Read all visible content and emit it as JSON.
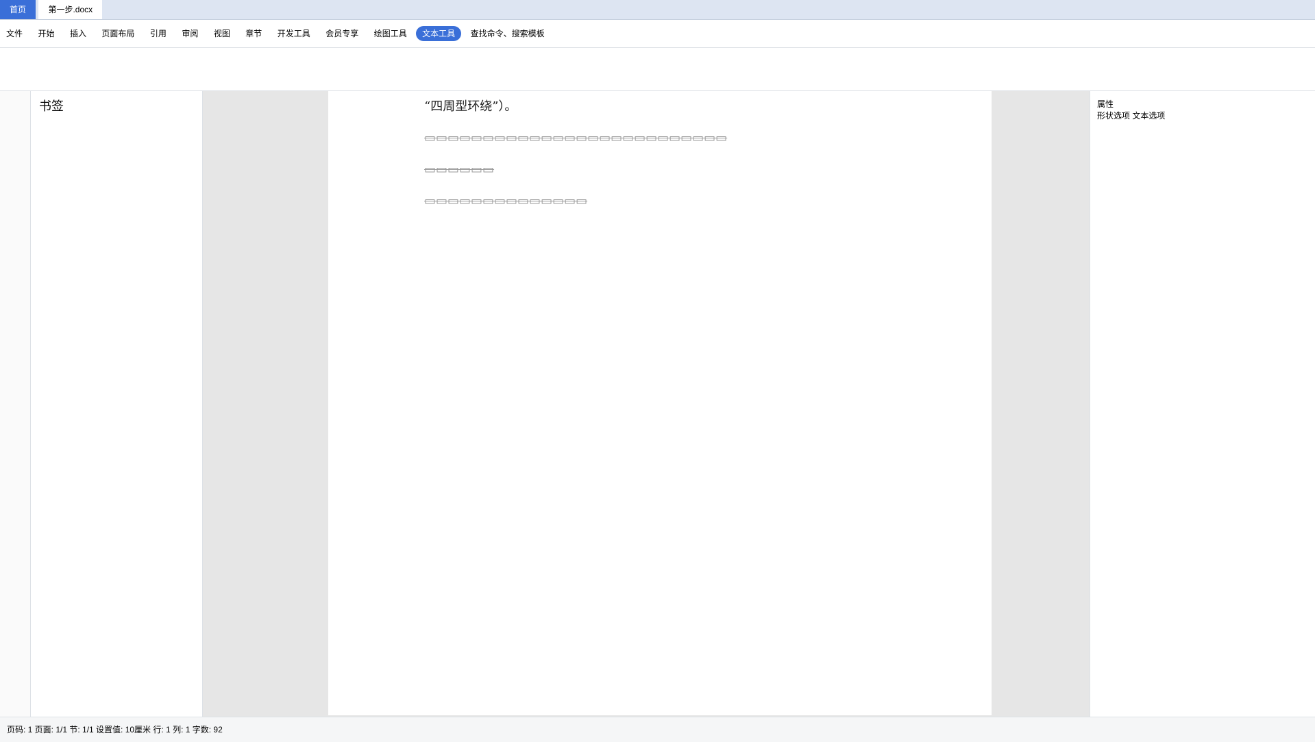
{
  "tabs": {
    "home": "首页",
    "doc": "第一步.docx"
  },
  "menu": {
    "file": "文件",
    "items": [
      "开始",
      "插入",
      "页面布局",
      "引用",
      "审阅",
      "视图",
      "章节",
      "开发工具",
      "会员专享"
    ],
    "draw": "绘图工具",
    "text": "文本工具",
    "search": "查找命令、搜索模板"
  },
  "panel": {
    "title": "书签"
  },
  "doc": {
    "line1": "“四周型环绕”）。"
  },
  "right": {
    "title": "属性",
    "tab1": "形状选项",
    "tab2": "文本选项"
  },
  "status": {
    "text": "页码: 1   页面: 1/1   节: 1/1   设置值: 10厘米   行: 1   列: 1   字数: 92"
  }
}
